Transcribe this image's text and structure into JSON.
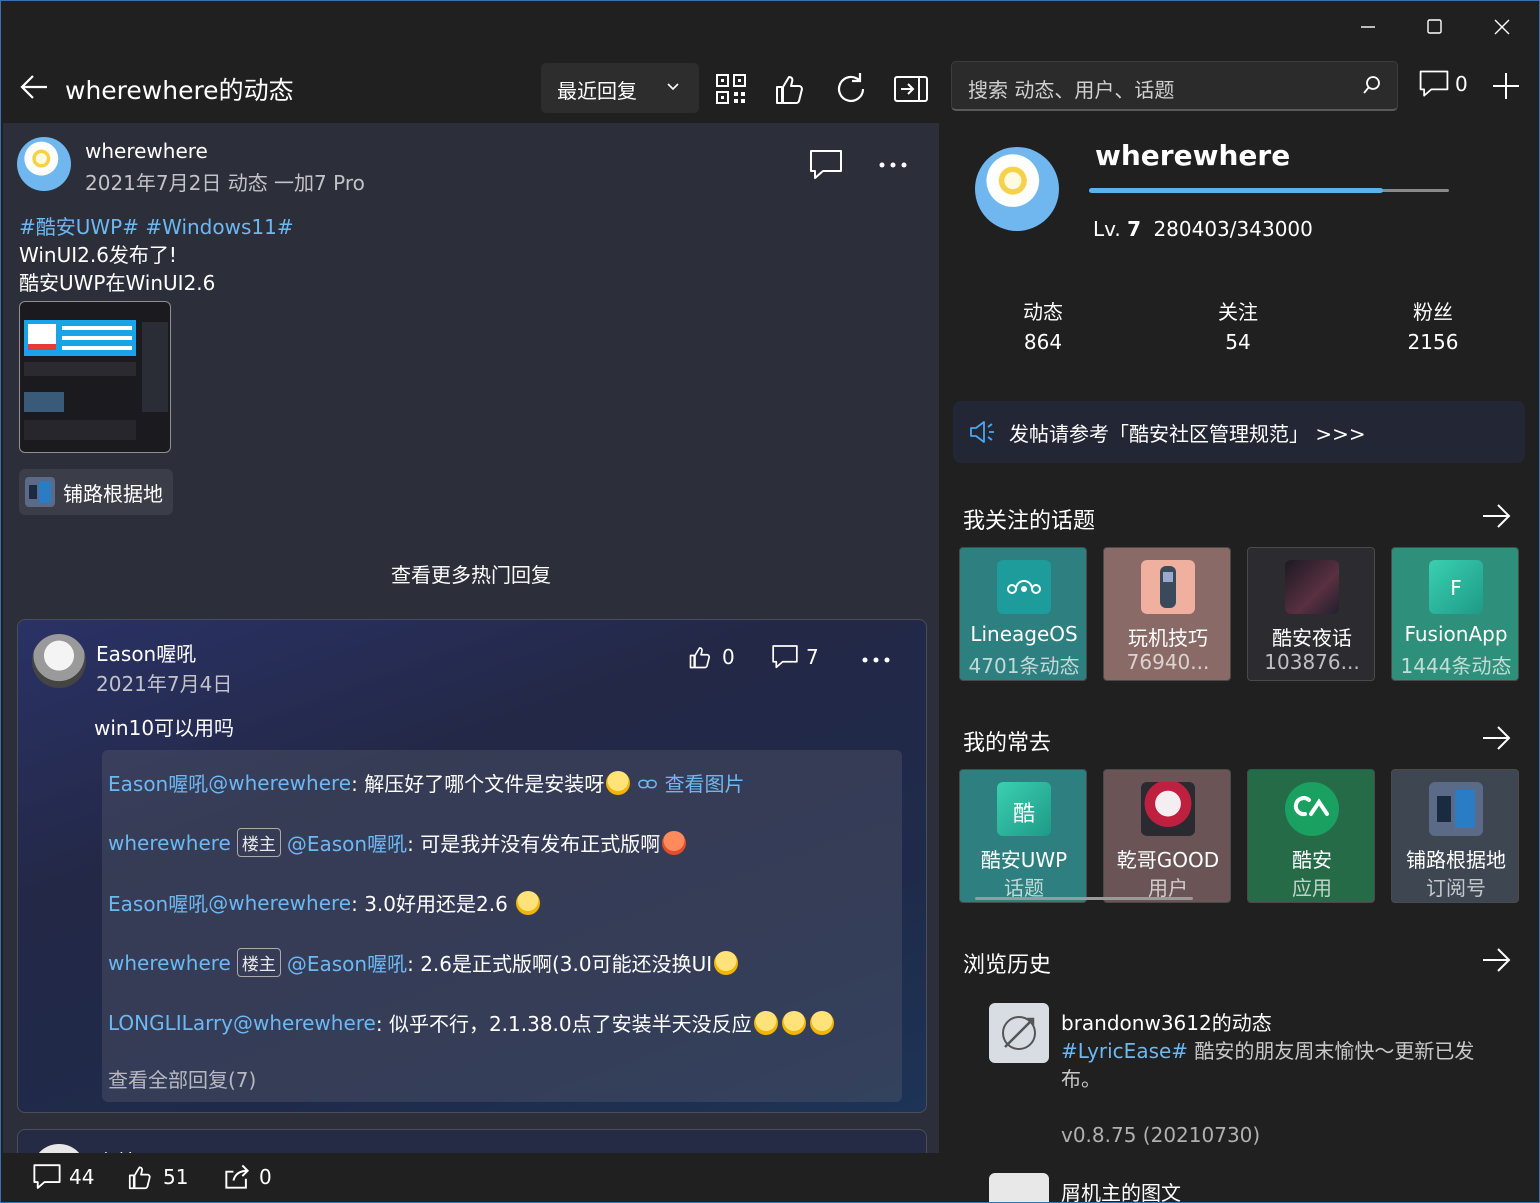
{
  "window": {
    "minimize": "minimize",
    "maximize": "maximize",
    "close": "close"
  },
  "header": {
    "title": "wherewhere的动态",
    "sort_label": "最近回复"
  },
  "post": {
    "author": "wherewhere",
    "meta": "2021年7月2日  动态  一加7 Pro",
    "tags": "#酷安UWP# #Windows11#",
    "line1": "WinUI2.6发布了!",
    "line2": "酷安UWP在WinUI2.6",
    "topic_chip": "铺路根据地",
    "more_hot": "查看更多热门回复"
  },
  "reply": {
    "author": "Eason喔吼",
    "date": "2021年7月4日",
    "likes": "0",
    "comments": "7",
    "text": "win10可以用吗",
    "sub": [
      {
        "user": "Eason喔吼",
        "at": "@wherewhere",
        "text": ": 解压好了哪个文件是安装呀",
        "link": "查看图片"
      },
      {
        "user": "wherewhere",
        "badge": "楼主",
        "at": "@Eason喔吼",
        "text": ": 可是我并没有发布正式版啊"
      },
      {
        "user": "Eason喔吼",
        "at": "@wherewhere",
        "text": ": 3.0好用还是2.6"
      },
      {
        "user": "wherewhere",
        "badge": "楼主",
        "at": "@Eason喔吼",
        "text": ": 2.6是正式版啊(3.0可能还没换UI"
      },
      {
        "user": "LONGLILarry",
        "at": "@wherewhere",
        "text": ": 似乎不行，2.1.38.0点了安装半天没反应"
      }
    ],
    "all_replies": "查看全部回复(7)"
  },
  "next_reply": {
    "author": "森林"
  },
  "bottom": {
    "comments": "44",
    "likes": "51",
    "shares": "0"
  },
  "search": {
    "placeholder": "搜索 动态、用户、话题"
  },
  "messages": {
    "count": "0"
  },
  "profile": {
    "name": "wherewhere",
    "level_label": "Lv.",
    "level": "7",
    "exp": "280403/343000",
    "progress": 0.817,
    "stats": [
      {
        "label": "动态",
        "value": "864"
      },
      {
        "label": "关注",
        "value": "54"
      },
      {
        "label": "粉丝",
        "value": "2156"
      }
    ]
  },
  "notice": "发帖请参考「酷安社区管理规范」 >>>",
  "followed_topics": {
    "title": "我关注的话题",
    "items": [
      {
        "name": "LineageOS",
        "sub": "4701条动态",
        "color": "#2e7f7f"
      },
      {
        "name": "玩机技巧",
        "sub": "76940...",
        "color": "#8a6a66"
      },
      {
        "name": "酷安夜话",
        "sub": "103876...",
        "color": "#2b2b30"
      },
      {
        "name": "FusionApp",
        "sub": "1444条动态",
        "color": "#2e8f7a"
      }
    ]
  },
  "frequent": {
    "title": "我的常去",
    "items": [
      {
        "name": "酷安UWP",
        "sub": "话题",
        "color": "#2e7f7f"
      },
      {
        "name": "乾哥GOOD",
        "sub": "用户",
        "color": "#6a5456"
      },
      {
        "name": "酷安",
        "sub": "应用",
        "color": "#256b48"
      },
      {
        "name": "铺路根据地",
        "sub": "订阅号",
        "color": "#3e4652"
      }
    ]
  },
  "history": {
    "title": "浏览历史",
    "items": [
      {
        "title": "brandonw3612的动态",
        "tag": "#LyricEase#",
        "desc": " 酷安的朋友周末愉快～更新已发布。",
        "version": "v0.8.75 (20210730)"
      },
      {
        "title": "屑机主的图文"
      }
    ]
  }
}
